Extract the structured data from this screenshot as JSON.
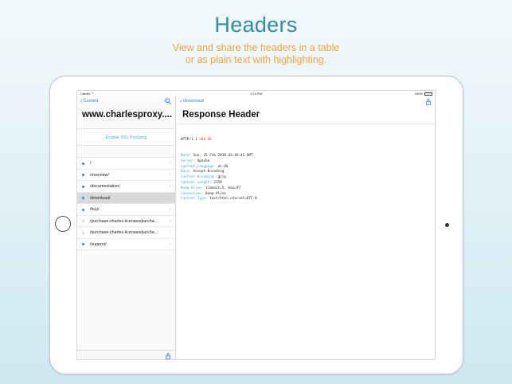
{
  "promo": {
    "title": "Headers",
    "subtitle_line1": "View and share the headers in a table",
    "subtitle_line2": "or as plain text with highlighting."
  },
  "status_bar": {
    "carrier": "Carrier",
    "time": "1:14 PM",
    "battery": "100%"
  },
  "master": {
    "back_label": "Current",
    "title": "www.charlesproxy....",
    "ssl_button": "Enable SSL Proxying",
    "rows": [
      {
        "path": "/",
        "active": true
      },
      {
        "path": "/overview/",
        "active": true
      },
      {
        "path": "/documentation/",
        "active": true
      },
      {
        "path": "/download/",
        "active": true,
        "selected": true
      },
      {
        "path": "/buy/",
        "active": true
      },
      {
        "path": "/purchase-charles-licenses/purcha...",
        "active": false
      },
      {
        "path": "/purchase-charles-licenses/purcha...",
        "active": false
      },
      {
        "path": "/support/",
        "active": true
      }
    ]
  },
  "detail": {
    "back_label": "/download/",
    "title": "Response Header",
    "status_line": {
      "protocol": "HTTP/1.1",
      "code": "200 OK"
    },
    "headers": [
      {
        "name": "Date:",
        "value": "Sun, 25 Feb 2018 03:46:45 GMT"
      },
      {
        "name": "Server:",
        "value": "Apache"
      },
      {
        "name": "Content-Language:",
        "value": "en-US"
      },
      {
        "name": "Vary:",
        "value": "Accept-Encoding"
      },
      {
        "name": "Content-Encoding:",
        "value": "gzip"
      },
      {
        "name": "Content-Length:",
        "value": "2359"
      },
      {
        "name": "Keep-Alive:",
        "value": "timeout=5, max=97"
      },
      {
        "name": "Connection:",
        "value": "Keep-Alive"
      },
      {
        "name": "Content-Type:",
        "value": "text/html;charset=UTF-8"
      }
    ]
  },
  "icons": {
    "back": "chevron-left-icon",
    "search": "search-icon",
    "share": "share-icon",
    "row_disclosure": "chevron-right-icon",
    "row_status": "status-dot-icon"
  },
  "colors": {
    "accent": "#2b7de9",
    "header_name": "#3ba6c9",
    "status_code": "#d94a4a",
    "title_teal": "#2f8ea0",
    "subtitle_orange": "#f0a637"
  }
}
